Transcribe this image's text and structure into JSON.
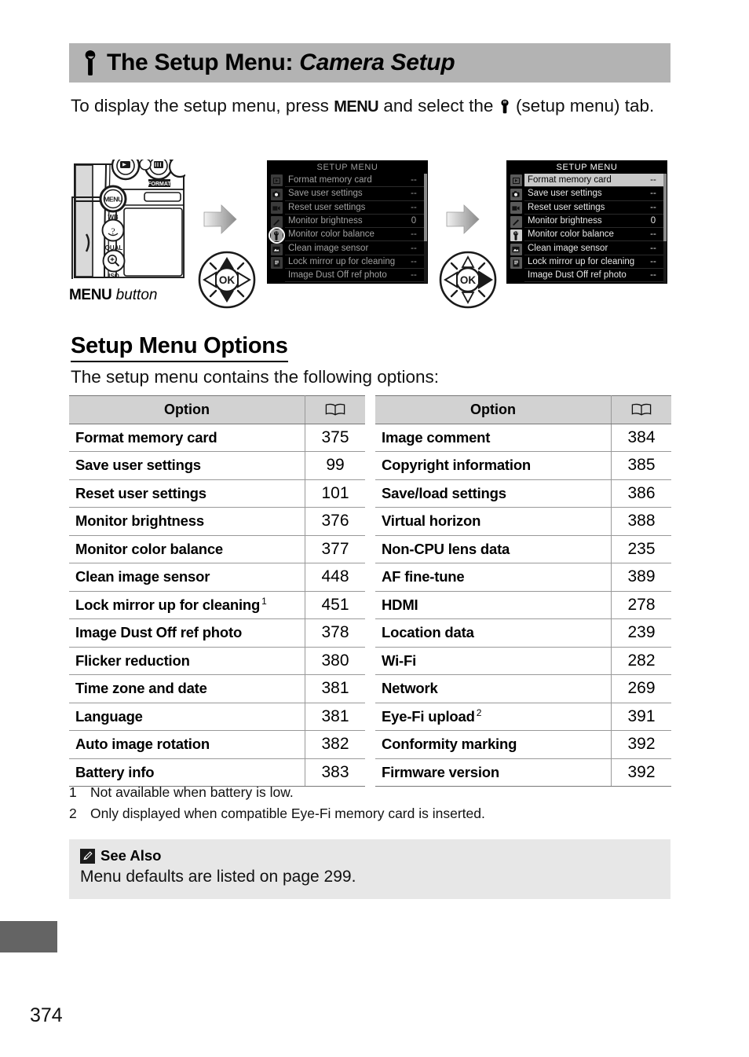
{
  "banner": {
    "icon": "wrench-icon",
    "title_main": "The Setup Menu:",
    "title_italic": "Camera Setup"
  },
  "intro": {
    "part1": "To display the setup menu, press ",
    "menu_word": "MENU",
    "part2": " and select the ",
    "wrench_icon": "wrench-icon",
    "part3": " (setup menu) tab."
  },
  "figure": {
    "camera_caption_bold": "MENU",
    "camera_caption_italic": " button",
    "arrow_1": "right-arrow-icon",
    "arrow_2": "right-arrow-icon",
    "multi_selector_1": "multi-selector-up-down-icon",
    "multi_selector_2": "multi-selector-right-icon",
    "screens": [
      {
        "name": "menu-screen-before",
        "title": "SETUP MENU",
        "tab_selected_index": 4,
        "tab_ring": true,
        "selected_row_index": -1,
        "tabs": [
          "playback-tab-icon",
          "shooting-tab-icon",
          "movie-tab-icon",
          "custom-settings-tab-icon",
          "setup-tab-icon",
          "retouch-tab-icon",
          "recent-settings-tab-icon"
        ],
        "rows": [
          {
            "label": "Format memory card",
            "value": "--"
          },
          {
            "label": "Save user settings",
            "value": "--"
          },
          {
            "label": "Reset user settings",
            "value": "--"
          },
          {
            "label": "Monitor brightness",
            "value": "0"
          },
          {
            "label": "Monitor color balance",
            "value": "--"
          },
          {
            "label": "Clean image sensor",
            "value": "--"
          },
          {
            "label": "Lock mirror up for cleaning",
            "value": "--"
          },
          {
            "label": "Image Dust Off ref photo",
            "value": "--"
          }
        ]
      },
      {
        "name": "menu-screen-after",
        "title": "SETUP MENU",
        "tab_selected_index": 4,
        "tab_ring": false,
        "selected_row_index": 0,
        "tabs": [
          "playback-tab-icon",
          "shooting-tab-icon",
          "movie-tab-icon",
          "custom-settings-tab-icon",
          "setup-tab-icon",
          "retouch-tab-icon",
          "recent-settings-tab-icon"
        ],
        "rows": [
          {
            "label": "Format memory card",
            "value": "--"
          },
          {
            "label": "Save user settings",
            "value": "--"
          },
          {
            "label": "Reset user settings",
            "value": "--"
          },
          {
            "label": "Monitor brightness",
            "value": "0"
          },
          {
            "label": "Monitor color balance",
            "value": "--"
          },
          {
            "label": "Clean image sensor",
            "value": "--"
          },
          {
            "label": "Lock mirror up for cleaning",
            "value": "--"
          },
          {
            "label": "Image Dust Off ref photo",
            "value": "--"
          }
        ]
      }
    ]
  },
  "section": {
    "heading": "Setup Menu Options",
    "intro": "The setup menu contains the following options:"
  },
  "tables": {
    "header_option": "Option",
    "header_page_icon": "open-book-icon",
    "left_rows": [
      {
        "option": "Format memory card",
        "footnote": "",
        "page": "375"
      },
      {
        "option": "Save user settings",
        "footnote": "",
        "page": "99"
      },
      {
        "option": "Reset user settings",
        "footnote": "",
        "page": "101"
      },
      {
        "option": "Monitor brightness",
        "footnote": "",
        "page": "376"
      },
      {
        "option": "Monitor color balance",
        "footnote": "",
        "page": "377"
      },
      {
        "option": "Clean image sensor",
        "footnote": "",
        "page": "448"
      },
      {
        "option": "Lock mirror up for cleaning",
        "footnote": "1",
        "page": "451"
      },
      {
        "option": "Image Dust Off ref photo",
        "footnote": "",
        "page": "378"
      },
      {
        "option": "Flicker reduction",
        "footnote": "",
        "page": "380"
      },
      {
        "option": "Time zone and date",
        "footnote": "",
        "page": "381"
      },
      {
        "option": "Language",
        "footnote": "",
        "page": "381"
      },
      {
        "option": "Auto image rotation",
        "footnote": "",
        "page": "382"
      },
      {
        "option": "Battery info",
        "footnote": "",
        "page": "383"
      }
    ],
    "right_rows": [
      {
        "option": "Image comment",
        "footnote": "",
        "page": "384"
      },
      {
        "option": "Copyright information",
        "footnote": "",
        "page": "385"
      },
      {
        "option": "Save/load settings",
        "footnote": "",
        "page": "386"
      },
      {
        "option": "Virtual horizon",
        "footnote": "",
        "page": "388"
      },
      {
        "option": "Non-CPU lens data",
        "footnote": "",
        "page": "235"
      },
      {
        "option": "AF fine-tune",
        "footnote": "",
        "page": "389"
      },
      {
        "option": "HDMI",
        "footnote": "",
        "page": "278"
      },
      {
        "option": "Location data",
        "footnote": "",
        "page": "239"
      },
      {
        "option": "Wi-Fi",
        "footnote": "",
        "page": "282"
      },
      {
        "option": "Network",
        "footnote": "",
        "page": "269"
      },
      {
        "option": "Eye-Fi upload",
        "footnote": "2",
        "page": "391"
      },
      {
        "option": "Conformity marking",
        "footnote": "",
        "page": "392"
      },
      {
        "option": "Firmware version",
        "footnote": "",
        "page": "392"
      }
    ]
  },
  "footnotes": [
    {
      "num": "1",
      "text": "Not available when battery is low."
    },
    {
      "num": "2",
      "text": "Only displayed when compatible Eye-Fi memory card is inserted."
    }
  ],
  "see_also": {
    "icon": "pencil-icon",
    "heading": "See Also",
    "text": "Menu defaults are listed on page 299."
  },
  "footer": {
    "page_number": "374"
  },
  "colors": {
    "banner_gray": "#b3b3b3",
    "table_header_gray": "#d2d2d2",
    "note_box_gray": "#e7e7e7",
    "edge_tab_gray": "#646464"
  }
}
